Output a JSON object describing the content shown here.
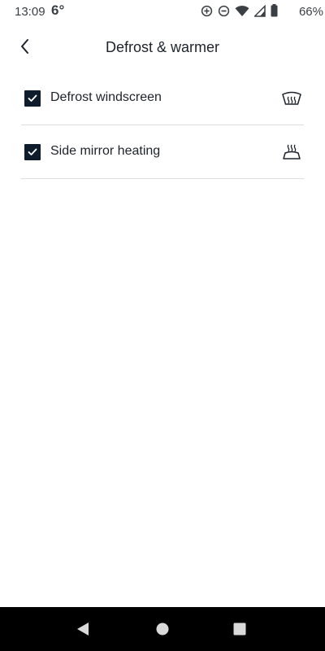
{
  "status_bar": {
    "time": "13:09",
    "temperature": "6°",
    "battery_percent": "66%",
    "icons": [
      "data-saver-icon",
      "do-not-disturb-icon",
      "wifi-icon",
      "signal-icon",
      "battery-icon"
    ]
  },
  "header": {
    "title": "Defrost & warmer",
    "back_icon": "chevron-left-icon"
  },
  "settings": {
    "items": [
      {
        "label": "Defrost windscreen",
        "checked": true,
        "icon": "windscreen-defrost-icon"
      },
      {
        "label": "Side mirror heating",
        "checked": true,
        "icon": "mirror-heating-icon"
      }
    ]
  },
  "nav_bar": {
    "buttons": [
      "back-triangle-icon",
      "home-circle-icon",
      "recents-square-icon"
    ]
  },
  "colors": {
    "checkbox_fill": "#0e1c2c",
    "text": "#1d232b",
    "divider": "#dcdee0",
    "nav_bar": "#000000"
  }
}
